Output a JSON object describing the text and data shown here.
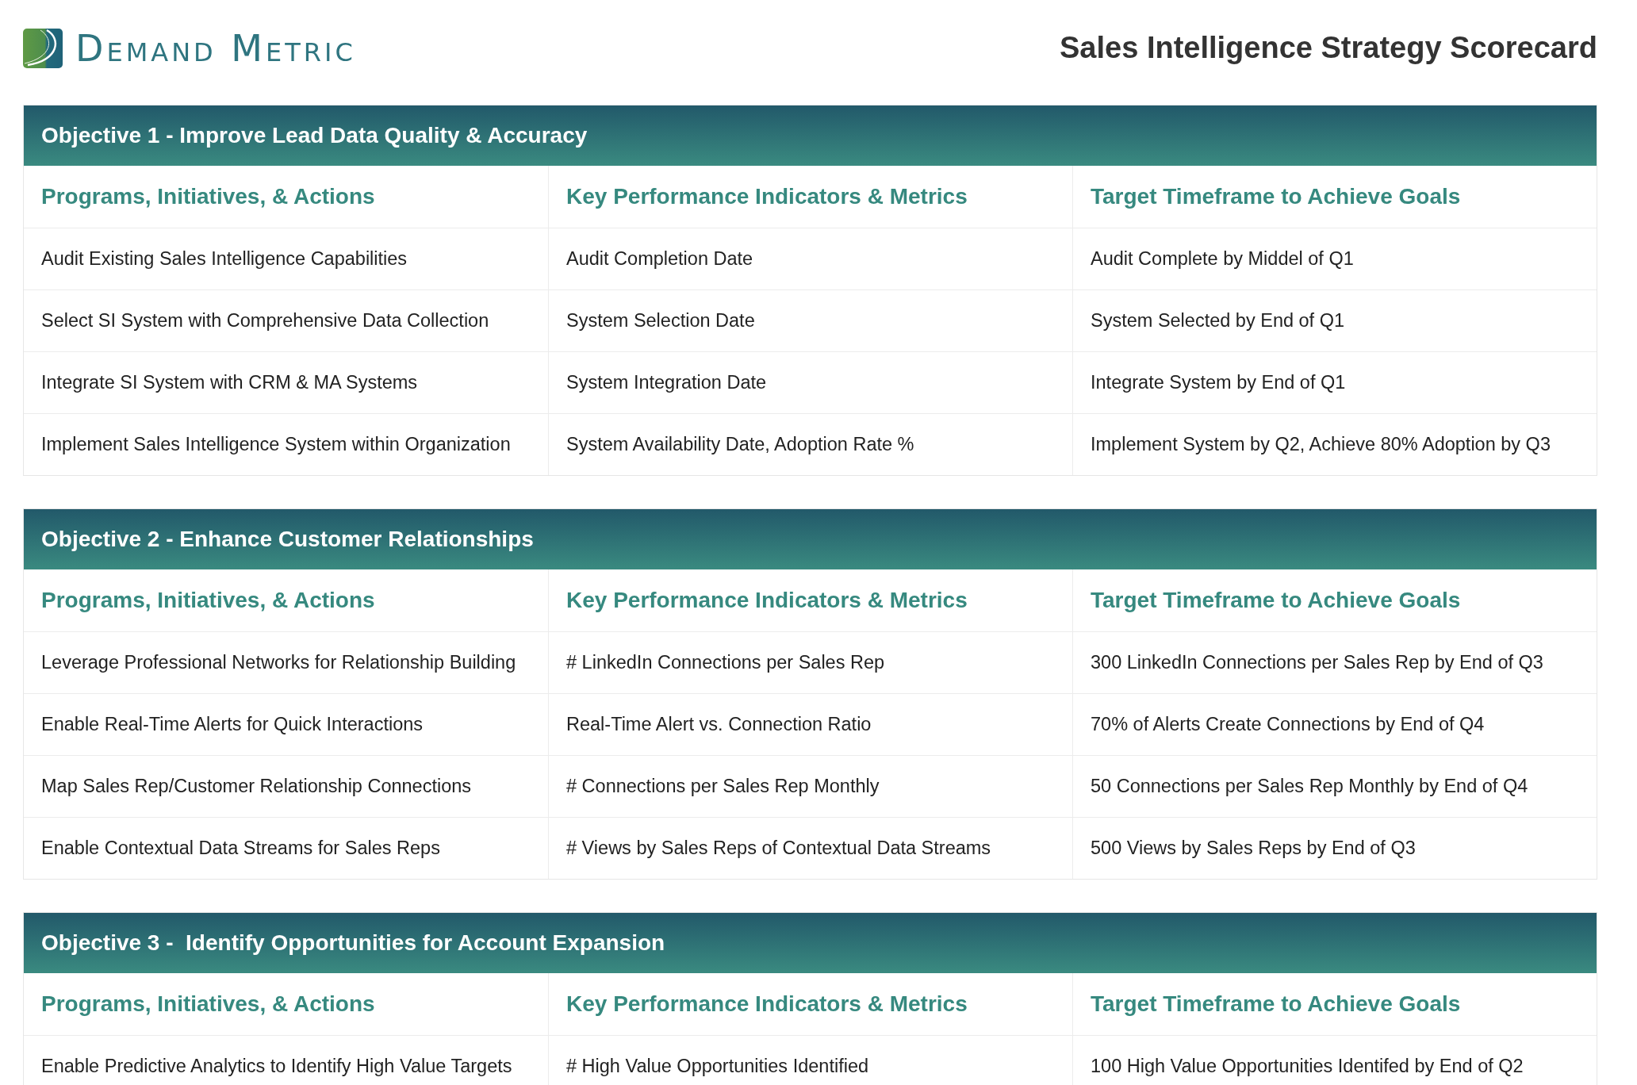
{
  "brand": {
    "name": "Demand Metric"
  },
  "title": "Sales Intelligence Strategy Scorecard",
  "objectives": [
    {
      "title": "Objective 1 - Improve Lead Data Quality & Accuracy",
      "columns": [
        "Programs, Initiatives, & Actions",
        "Key Performance Indicators & Metrics",
        "Target Timeframe to Achieve Goals"
      ],
      "rows": [
        [
          "Audit Existing Sales Intelligence Capabilities",
          "Audit Completion Date",
          "Audit Complete by Middel of Q1"
        ],
        [
          "Select SI System with Comprehensive Data Collection",
          "System Selection Date",
          "System Selected by End of Q1"
        ],
        [
          "Integrate SI System with CRM & MA Systems",
          "System Integration Date",
          "Integrate System by End of Q1"
        ],
        [
          "Implement Sales Intelligence System within Organization",
          "System Availability Date, Adoption Rate %",
          "Implement System by Q2, Achieve 80% Adoption by Q3"
        ]
      ]
    },
    {
      "title": "Objective 2 - Enhance Customer Relationships",
      "columns": [
        "Programs, Initiatives, & Actions",
        "Key Performance Indicators & Metrics",
        "Target Timeframe to Achieve Goals"
      ],
      "rows": [
        [
          "Leverage Professional Networks for Relationship Building",
          "# LinkedIn Connections per Sales Rep",
          "300 LinkedIn Connections per Sales Rep by End of Q3"
        ],
        [
          "Enable Real-Time Alerts for Quick Interactions",
          "Real-Time Alert vs. Connection Ratio",
          "70% of Alerts Create Connections by End of Q4"
        ],
        [
          "Map Sales Rep/Customer Relationship Connections",
          "# Connections per Sales Rep Monthly",
          "50 Connections per Sales Rep Monthly by End of Q4"
        ],
        [
          "Enable Contextual Data Streams for Sales Reps",
          "# Views by Sales Reps of Contextual Data Streams",
          "500 Views by Sales Reps by End of Q3"
        ]
      ]
    },
    {
      "title": "Objective 3 -  Identify Opportunities for Account Expansion",
      "columns": [
        "Programs, Initiatives, & Actions",
        "Key Performance Indicators & Metrics",
        "Target Timeframe to Achieve Goals"
      ],
      "rows": [
        [
          "Enable Predictive Analytics to Identify High Value Targets",
          "# High Value Opportunities Identified",
          "100 High Value Opportunities Identifed by End of Q2"
        ]
      ]
    }
  ]
}
